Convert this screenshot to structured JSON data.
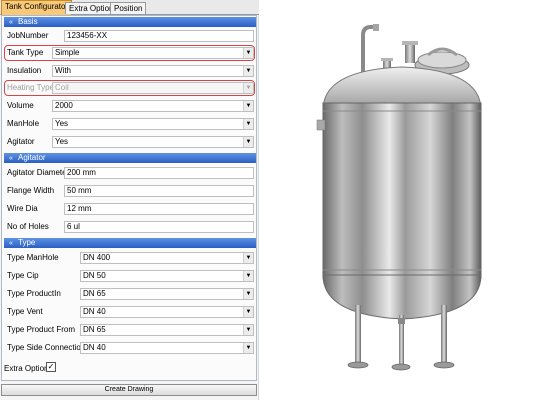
{
  "tabs": [
    "Tank Configurator",
    "Extra Option",
    "Position"
  ],
  "sections": {
    "basis": "Basis",
    "agitator": "Agitator",
    "type": "Type"
  },
  "basis": {
    "job_number": {
      "label": "JobNumber",
      "value": "123456-XX"
    },
    "tank_type": {
      "label": "Tank Type",
      "value": "Simple"
    },
    "insulation": {
      "label": "Insulation",
      "value": "With"
    },
    "heating_type": {
      "label": "Heating Type",
      "value": "Coil"
    },
    "volume": {
      "label": "Volume",
      "value": "2000"
    },
    "manhole": {
      "label": "ManHole",
      "value": "Yes"
    },
    "agitator": {
      "label": "Agitator",
      "value": "Yes"
    }
  },
  "agitator": {
    "diameter": {
      "label": "Agitator Diameter",
      "value": "200 mm"
    },
    "flange_width": {
      "label": "Flange Width",
      "value": "50 mm"
    },
    "wire_dia": {
      "label": "Wire Dia",
      "value": "12 mm"
    },
    "no_of_holes": {
      "label": "No of Holes",
      "value": "6 ul"
    }
  },
  "type": {
    "manhole": {
      "label": "Type ManHole",
      "value": "DN 400"
    },
    "cip": {
      "label": "Type Cip",
      "value": "DN 50"
    },
    "product_in": {
      "label": "Type ProductIn",
      "value": "DN 65"
    },
    "vent": {
      "label": "Type Vent",
      "value": "DN 40"
    },
    "product_from": {
      "label": "Type Product From",
      "value": "DN 65"
    },
    "side_connection": {
      "label": "Type Side Connection",
      "value": "DN 40"
    }
  },
  "extra_option": {
    "label": "Extra Option",
    "checked": true
  },
  "create_button": "Create Drawing",
  "colors": {
    "active_tab": "#f7c978",
    "section_header": "#2a60c4",
    "highlight_border": "#d64545"
  },
  "icons": {
    "section_collapse": "double-chevron-up-icon",
    "dropdown": "dropdown-arrow-icon"
  }
}
